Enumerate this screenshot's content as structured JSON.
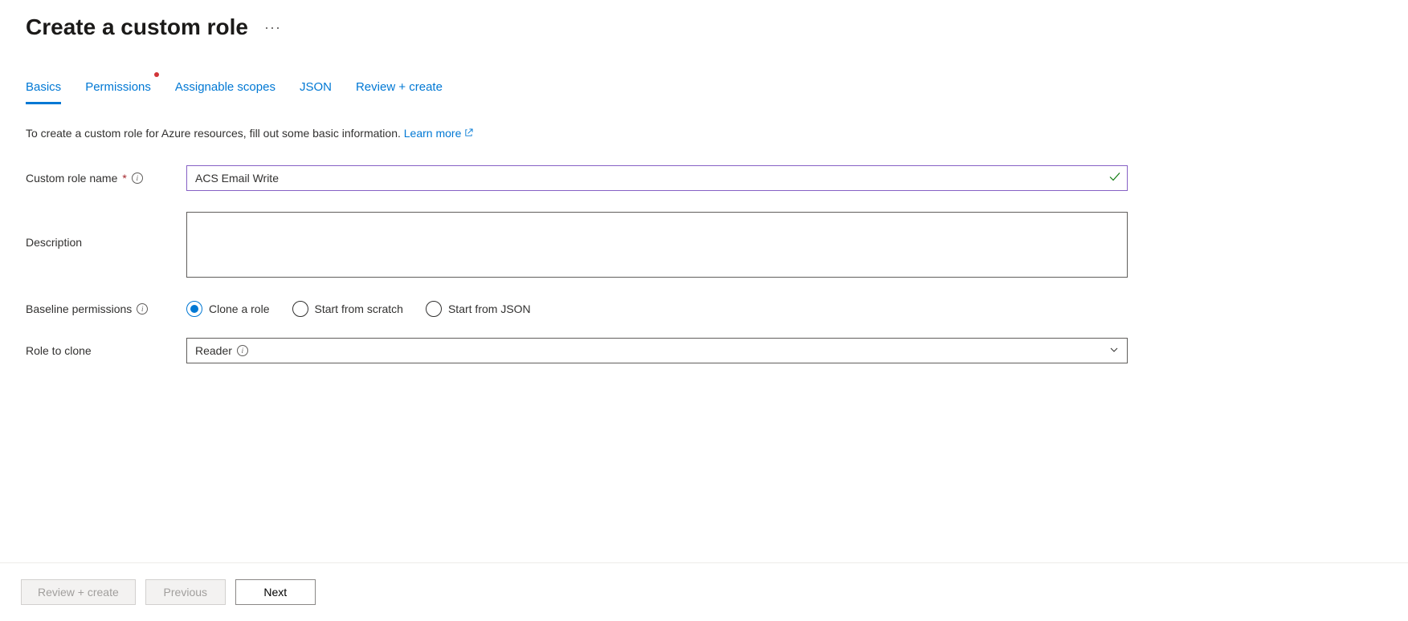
{
  "header": {
    "title": "Create a custom role"
  },
  "tabs": [
    {
      "label": "Basics",
      "active": true,
      "dot": false
    },
    {
      "label": "Permissions",
      "active": false,
      "dot": true
    },
    {
      "label": "Assignable scopes",
      "active": false,
      "dot": false
    },
    {
      "label": "JSON",
      "active": false,
      "dot": false
    },
    {
      "label": "Review + create",
      "active": false,
      "dot": false
    }
  ],
  "intro": {
    "text": "To create a custom role for Azure resources, fill out some basic information. ",
    "link_text": "Learn more"
  },
  "form": {
    "role_name": {
      "label": "Custom role name",
      "value": "ACS Email Write",
      "required": true,
      "valid": true
    },
    "description": {
      "label": "Description",
      "value": ""
    },
    "baseline": {
      "label": "Baseline permissions",
      "options": [
        {
          "label": "Clone a role",
          "selected": true
        },
        {
          "label": "Start from scratch",
          "selected": false
        },
        {
          "label": "Start from JSON",
          "selected": false
        }
      ]
    },
    "role_to_clone": {
      "label": "Role to clone",
      "value": "Reader"
    }
  },
  "footer": {
    "review_create": "Review + create",
    "previous": "Previous",
    "next": "Next"
  }
}
